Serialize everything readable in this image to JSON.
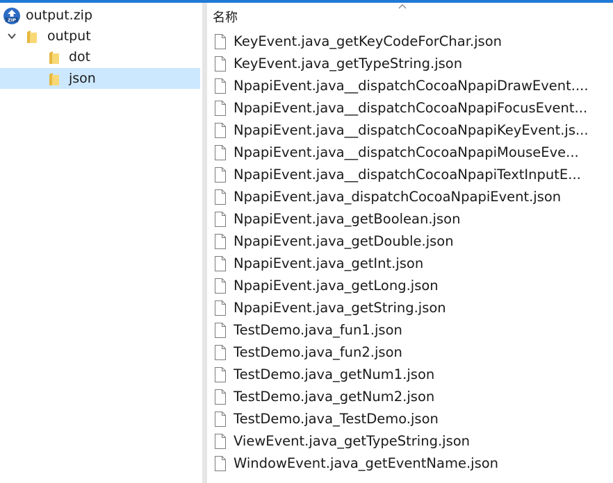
{
  "nav": {
    "root": {
      "label": "output.zip",
      "icon": "zip-archive-icon"
    },
    "folder": {
      "label": "output",
      "expanded": true,
      "icon": "folder-icon"
    },
    "children": [
      {
        "label": "dot",
        "selected": false
      },
      {
        "label": "json",
        "selected": true
      }
    ]
  },
  "list": {
    "column_header": "名称",
    "sort": "ascending",
    "files": [
      "KeyEvent.java_getKeyCodeForChar.json",
      "KeyEvent.java_getTypeString.json",
      "NpapiEvent.java__dispatchCocoaNpapiDrawEvent....",
      "NpapiEvent.java__dispatchCocoaNpapiFocusEvent...",
      "NpapiEvent.java__dispatchCocoaNpapiKeyEvent.js...",
      "NpapiEvent.java__dispatchCocoaNpapiMouseEve...",
      "NpapiEvent.java__dispatchCocoaNpapiTextInputE...",
      "NpapiEvent.java_dispatchCocoaNpapiEvent.json",
      "NpapiEvent.java_getBoolean.json",
      "NpapiEvent.java_getDouble.json",
      "NpapiEvent.java_getInt.json",
      "NpapiEvent.java_getLong.json",
      "NpapiEvent.java_getString.json",
      "TestDemo.java_fun1.json",
      "TestDemo.java_fun2.json",
      "TestDemo.java_getNum1.json",
      "TestDemo.java_getNum2.json",
      "TestDemo.java_TestDemo.json",
      "ViewEvent.java_getTypeString.json",
      "WindowEvent.java_getEventName.json"
    ]
  },
  "colors": {
    "accent": "#1e7ad6",
    "selection": "#cce8ff",
    "folder": "#f8d775",
    "folder_dark": "#e6b740"
  }
}
